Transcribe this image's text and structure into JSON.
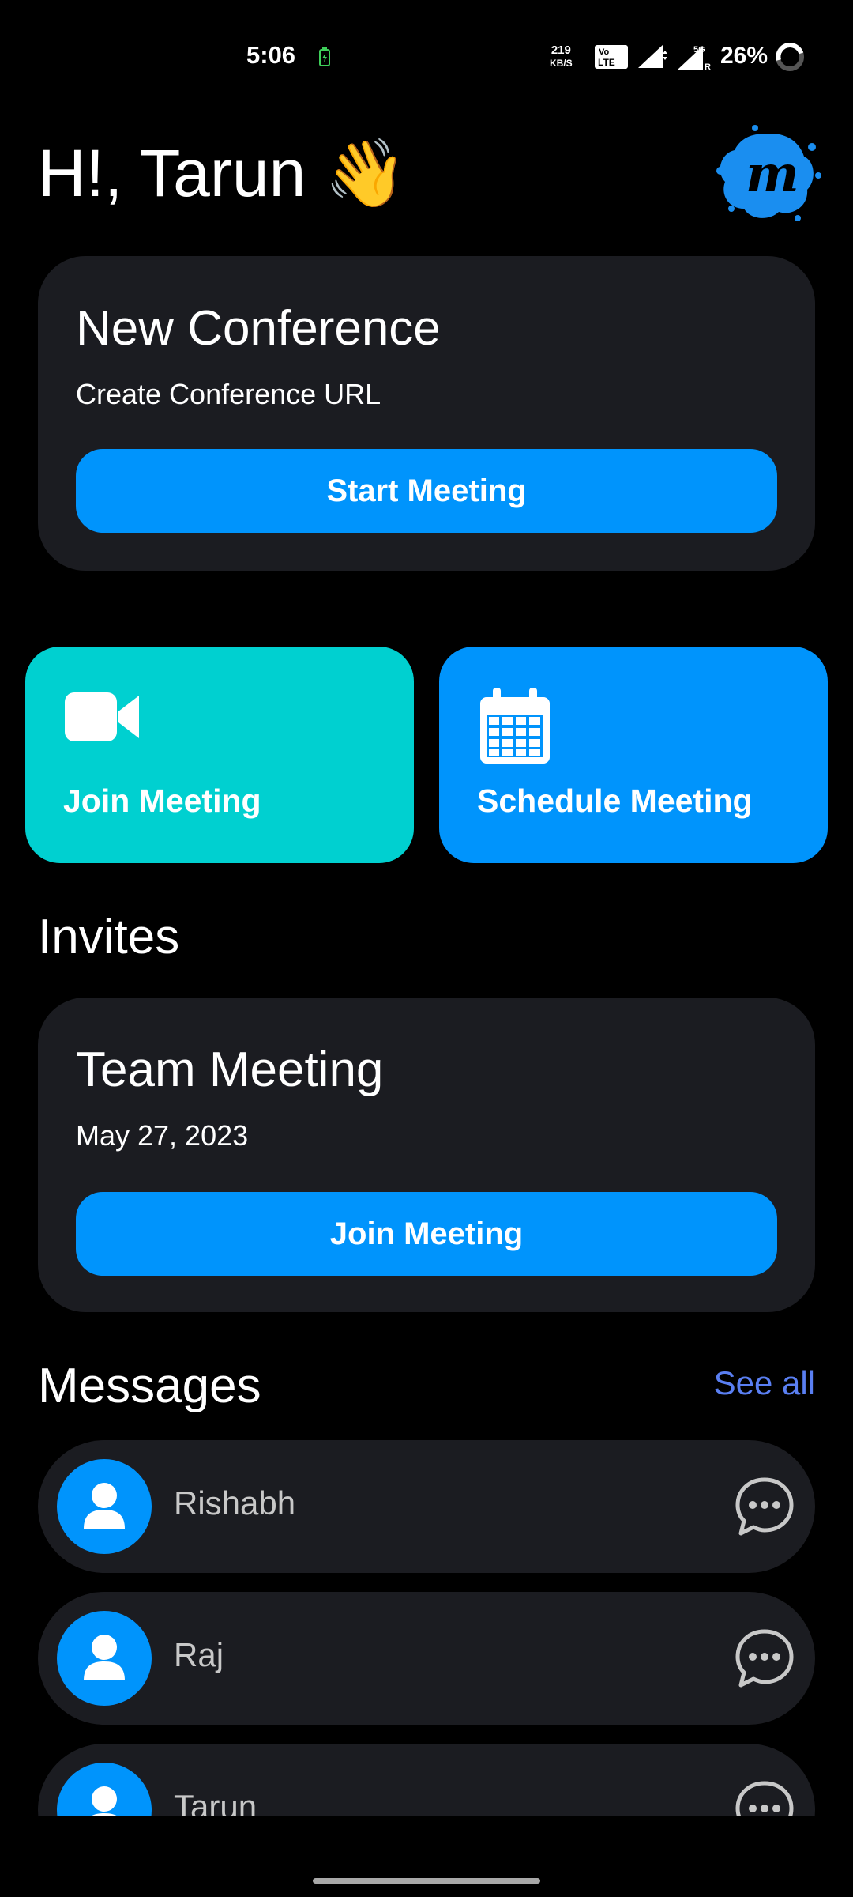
{
  "status_bar": {
    "time": "5:06",
    "net_speed_value": "219",
    "net_speed_unit": "KB/S",
    "volte_line1": "Vo",
    "volte_line2": "LTE",
    "signal2_label": "5G",
    "signal2_sub": "R",
    "battery": "26%"
  },
  "header": {
    "greeting": "H!, Tarun 👋",
    "logo_letter": "m"
  },
  "new_conference": {
    "title": "New Conference",
    "subtitle": "Create Conference URL",
    "button": "Start Meeting"
  },
  "tiles": {
    "join": "Join Meeting",
    "schedule": "Schedule Meeting"
  },
  "invites": {
    "section_title": "Invites",
    "items": [
      {
        "title": "Team Meeting",
        "date": "May 27, 2023",
        "button": "Join Meeting"
      }
    ]
  },
  "messages": {
    "section_title": "Messages",
    "see_all": "See all",
    "items": [
      {
        "name": "Rishabh"
      },
      {
        "name": "Raj"
      },
      {
        "name": "Tarun"
      }
    ]
  },
  "colors": {
    "background": "#000000",
    "card": "#1b1c21",
    "primary": "#0094fc",
    "teal": "#00d0d0",
    "link": "#5a7ff2"
  },
  "icons": [
    "battery-charging-icon",
    "signal-icon",
    "battery-ring-icon",
    "app-logo-icon",
    "video-camera-icon",
    "calendar-icon",
    "user-icon",
    "chat-bubble-icon"
  ]
}
